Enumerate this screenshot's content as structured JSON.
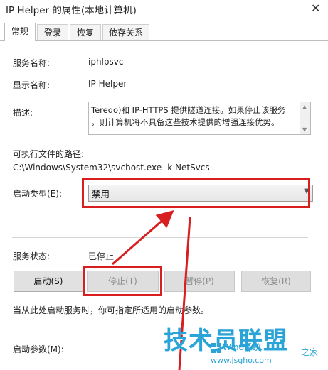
{
  "window": {
    "title": "IP Helper 的属性(本地计算机)",
    "close_glyph": "✕"
  },
  "tabs": [
    {
      "label": "常规"
    },
    {
      "label": "登录"
    },
    {
      "label": "恢复"
    },
    {
      "label": "依存关系"
    }
  ],
  "fields": {
    "service_name_label": "服务名称:",
    "service_name_value": "iphlpsvc",
    "display_name_label": "显示名称:",
    "display_name_value": "IP Helper",
    "description_label": "描述:",
    "description_line1": "Teredo)和 IP-HTTPS 提供隧道连接。如果停止该服务",
    "description_line2": "，则计算机将不具备这些技术提供的增强连接优势。",
    "exec_path_label": "可执行文件的路径:",
    "exec_path_value": "C:\\Windows\\System32\\svchost.exe -k NetSvcs",
    "startup_type_label": "启动类型(E):",
    "startup_type_value": "禁用"
  },
  "status": {
    "label": "服务状态:",
    "value": "已停止"
  },
  "buttons": {
    "start": "启动(S)",
    "stop": "停止(T)",
    "pause": "暂停(P)",
    "resume": "恢复(R)"
  },
  "hint_text": "当从此处启动服务时，你可指定所适用的启动参数。",
  "start_params_label": "启动参数(M):",
  "watermark": {
    "main": "技术员联盟",
    "site": "www.jsgho.com",
    "win_text": "Win8系统",
    "zhi_jia": "之家"
  },
  "colors": {
    "highlight_red": "#d81e1e",
    "watermark_blue": "#2aa3d6"
  }
}
